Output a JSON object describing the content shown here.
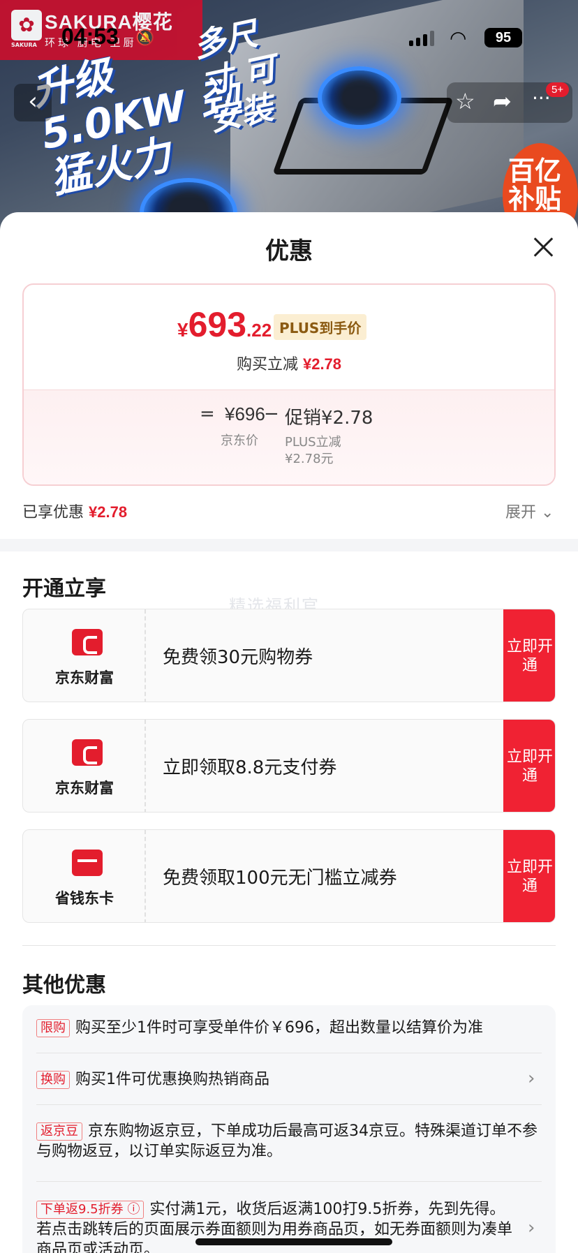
{
  "status_bar": {
    "time": "04:53",
    "battery": "95"
  },
  "hero": {
    "brand_name": "SAKURA樱花",
    "brand_sub": "环球 厨电 卫厨",
    "brand_small": "SAKURA",
    "promo_power": "升级 5.0KW 劲猛火力",
    "promo_size": "多尺寸 可安装",
    "badge": "百亿 补贴",
    "cart_count": "5+"
  },
  "sheet": {
    "title": "优惠",
    "price": {
      "symbol": "¥",
      "integer": "693",
      "decimal": ".22",
      "tag": "PLUS到手价"
    },
    "reduce_label": "购买立减",
    "reduce_value": "¥2.78",
    "calc": {
      "equals": "=",
      "jd_price": "¥696",
      "minus": "−",
      "promo": "促销¥2.78",
      "jd_price_label": "京东价",
      "plus_label_1": "PLUS立减",
      "plus_label_2": "¥2.78元"
    },
    "enjoyed_label": "已享优惠",
    "enjoyed_value": "¥2.78",
    "expand_label": "展开 ⌄"
  },
  "open_section": {
    "title": "开通立享",
    "watermark": "精选福利官",
    "coupons": [
      {
        "source": "京东财富",
        "desc": "免费领30元购物券",
        "button": "立即开通"
      },
      {
        "source": "京东财富",
        "desc": "立即领取8.8元支付券",
        "button": "立即开通"
      },
      {
        "source": "省钱东卡",
        "desc": "免费领取100元无门槛立减券",
        "button": "立即开通"
      }
    ]
  },
  "other_section": {
    "title": "其他优惠",
    "items": [
      {
        "tag": "限购",
        "text": "购买至少1件时可享受单件价￥696，超出数量以结算价为准"
      },
      {
        "tag": "换购",
        "text": "购买1件可优惠换购热销商品"
      },
      {
        "tag": "返京豆",
        "text": "京东购物返京豆，下单成功后最高可返34京豆。特殊渠道订单不参与购物返豆，以订单实际返豆为准。"
      },
      {
        "tag": "下单返9.5折券 ⓘ",
        "text": "实付满1元，收货后返满100打9.5折券，先到先得。若点击跳转后的页面展示券面额则为用券商品页，如无券面额则为凑单商品页或活动页。"
      }
    ]
  }
}
